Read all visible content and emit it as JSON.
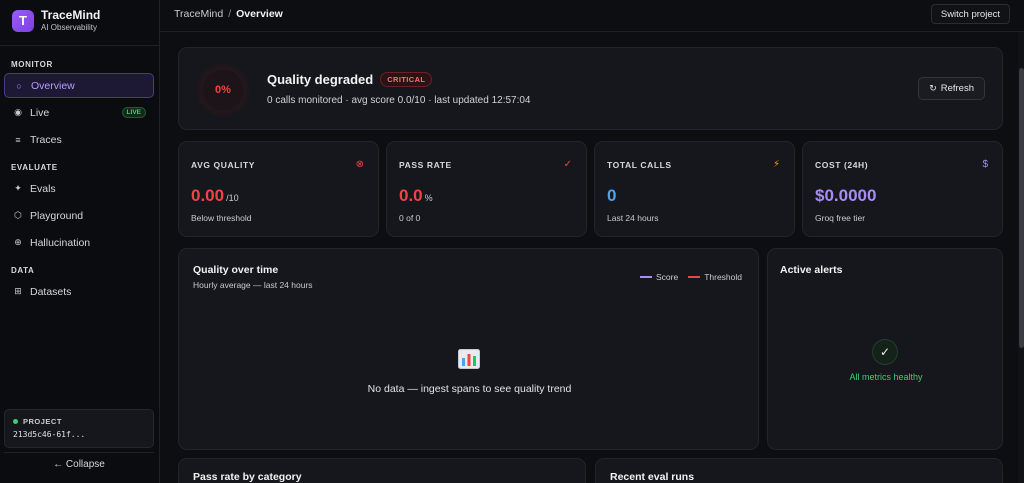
{
  "app": {
    "name": "TraceMind",
    "subtitle": "AI Observability",
    "logo_letter": "T"
  },
  "sidebar": {
    "sections": {
      "monitor": "MONITOR",
      "evaluate": "EVALUATE",
      "data": "DATA"
    },
    "items": [
      {
        "label": "Overview",
        "icon": "circle-outline-icon",
        "active": true
      },
      {
        "label": "Live",
        "icon": "radio-dot-icon",
        "badge": "LIVE"
      },
      {
        "label": "Traces",
        "icon": "lines-icon"
      },
      {
        "label": "Evals",
        "icon": "sparkle-icon"
      },
      {
        "label": "Playground",
        "icon": "hexagon-icon"
      },
      {
        "label": "Hallucination",
        "icon": "crosshair-icon"
      },
      {
        "label": "Datasets",
        "icon": "grid-icon"
      }
    ],
    "project": {
      "label": "PROJECT",
      "id": "213d5c46-61f..."
    },
    "collapse_label": "← Collapse"
  },
  "topbar": {
    "breadcrumb_root": "TraceMind",
    "breadcrumb_sep": "/",
    "breadcrumb_current": "Overview",
    "switch_label": "Switch project"
  },
  "hero": {
    "score_percent": "0%",
    "title": "Quality degraded",
    "badge": "CRITICAL",
    "subtitle": "0 calls monitored · avg score 0.0/10 · last updated 12:57:04",
    "refresh_label": "Refresh"
  },
  "cards": [
    {
      "title": "AVG QUALITY",
      "value": "0.00",
      "unit": "/10",
      "sub": "Below threshold",
      "icon": "x-circle-icon",
      "color": "#ef4444"
    },
    {
      "title": "PASS RATE",
      "value": "0.0",
      "unit": "%",
      "sub": "0 of 0",
      "icon": "check-icon",
      "color": "#ef4444"
    },
    {
      "title": "TOTAL CALLS",
      "value": "0",
      "unit": "",
      "sub": "Last 24 hours",
      "icon": "lightning-icon",
      "color": "#4aa3f0"
    },
    {
      "title": "COST (24H)",
      "value": "$0.0000",
      "unit": "",
      "sub": "Groq free tier",
      "icon": "dollar-icon",
      "color": "#a78bfa"
    }
  ],
  "quality_chart": {
    "title": "Quality over time",
    "subtitle": "Hourly average — last 24 hours",
    "legend": [
      {
        "name": "Score",
        "color": "#a78bfa"
      },
      {
        "name": "Threshold",
        "color": "#ef4444"
      }
    ],
    "empty_text": "No data — ingest spans to see quality trend"
  },
  "alerts": {
    "title": "Active alerts",
    "status": "All metrics healthy"
  },
  "bottom": {
    "left_title": "Pass rate by category",
    "right_title": "Recent eval runs"
  }
}
